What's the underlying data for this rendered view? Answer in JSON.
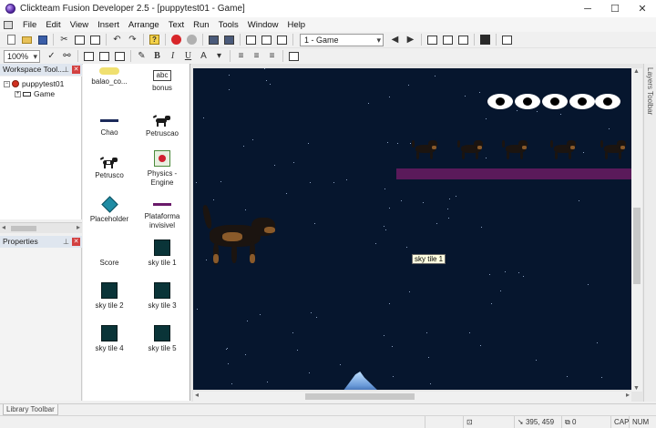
{
  "window": {
    "title": "Clickteam Fusion Developer 2.5 - [puppytest01 - Game]",
    "minimize": "─",
    "maximize": "☐",
    "close": "✕"
  },
  "menu": [
    "File",
    "Edit",
    "View",
    "Insert",
    "Arrange",
    "Text",
    "Run",
    "Tools",
    "Window",
    "Help"
  ],
  "toolbar": {
    "frame_select": "1 - Game",
    "zoom": "100%",
    "bold": "B",
    "italic": "I",
    "underline": "U"
  },
  "workspace": {
    "title": "Workspace Tool...",
    "tree": [
      {
        "label": "puppytest01"
      },
      {
        "label": "Game"
      }
    ]
  },
  "properties": {
    "title": "Properties"
  },
  "objects": [
    {
      "label": "balao_co...",
      "icon": "cloud-balloon"
    },
    {
      "label": "bonus",
      "icon": "abc-text",
      "icon_text": "abc"
    },
    {
      "label": "Chao",
      "icon": "line-navy"
    },
    {
      "label": "Petruscao",
      "icon": "dog"
    },
    {
      "label": "Petrusco",
      "icon": "dog-spotted"
    },
    {
      "label": "Physics - Engine",
      "icon": "physics-engine"
    },
    {
      "label": "Placeholder",
      "icon": "diamond"
    },
    {
      "label": "Plataforma invisivel",
      "icon": "line-purple"
    },
    {
      "label": "Score",
      "icon": "none"
    },
    {
      "label": "sky tile 1",
      "icon": "sky-tile"
    },
    {
      "label": "sky tile 2",
      "icon": "sky-tile"
    },
    {
      "label": "sky tile 3",
      "icon": "sky-tile"
    },
    {
      "label": "sky tile 4",
      "icon": "sky-tile"
    },
    {
      "label": "sky tile 5",
      "icon": "sky-tile"
    }
  ],
  "editor": {
    "tooltip": "sky tile 1",
    "background": "#06162e",
    "platform_color": "#5a1a5a"
  },
  "side_tabs": {
    "layers": "Layers Toolbar",
    "library": "Library Toolbar"
  },
  "status": {
    "coords": "395, 459",
    "zero_label": "0",
    "caps": "CAP",
    "num": "NUM"
  }
}
